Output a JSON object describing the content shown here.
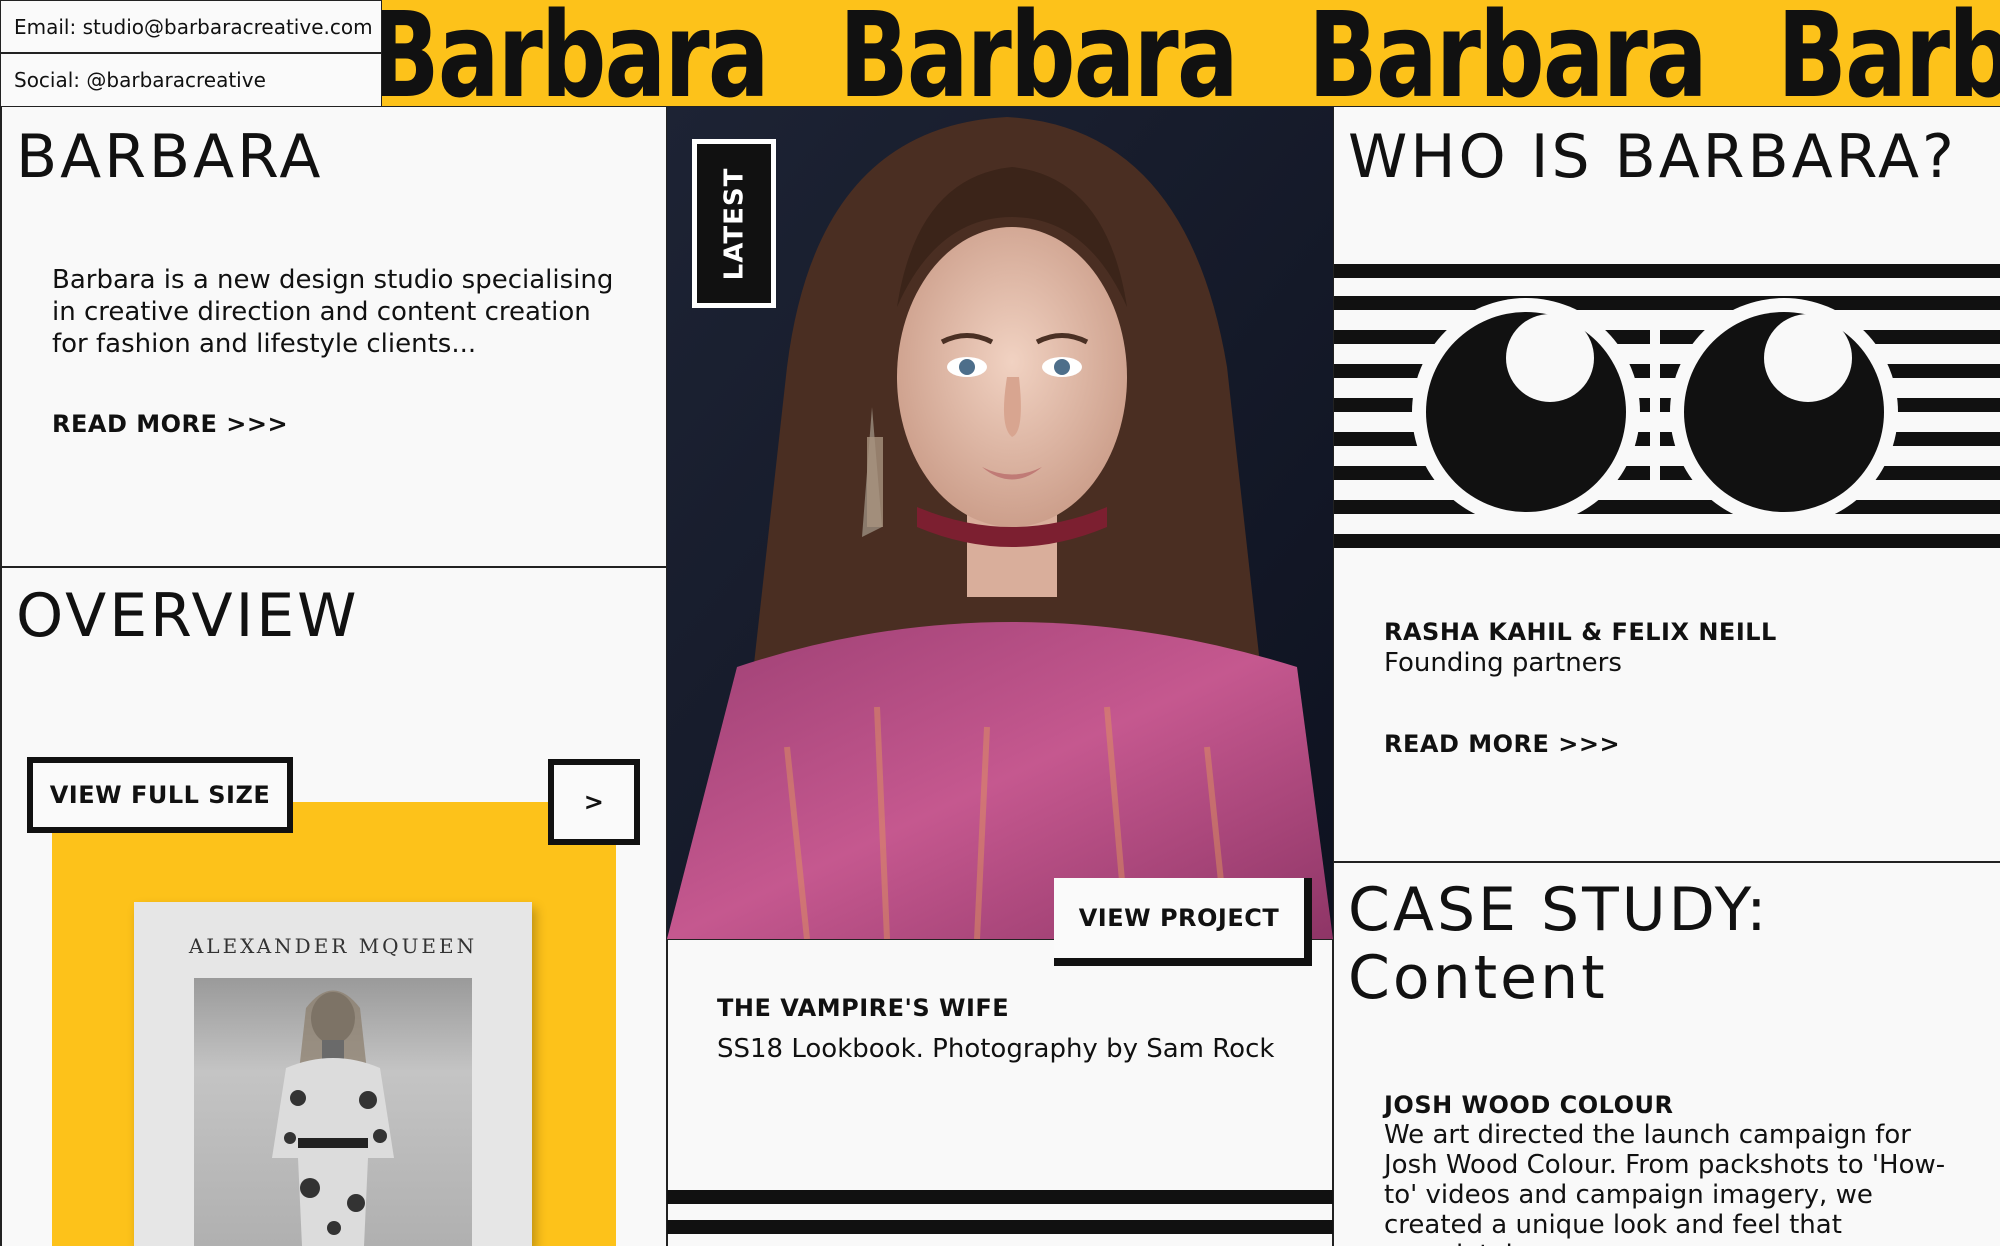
{
  "header": {
    "email": "Email: studio@barbaracreative.com",
    "social": "Social: @barbaracreative",
    "marquee_word": "Barbara"
  },
  "intro": {
    "title": "BARBARA",
    "text": "Barbara is a new design studio specialising in creative direction and content creation for fashion and lifestyle clients...",
    "read_more": "READ MORE >>>"
  },
  "overview": {
    "title": "OVERVIEW",
    "view_full_size": "VIEW FULL SIZE",
    "next": ">",
    "book_title": "ALEXANDER MQUEEN"
  },
  "latest": {
    "tag": "LATEST",
    "view_project": "VIEW PROJECT",
    "project_title": "THE VAMPIRE'S WIFE",
    "project_subtitle": "SS18 Lookbook. Photography by Sam Rock"
  },
  "who": {
    "title": "WHO IS BARBARA?",
    "partners": "RASHA KAHIL & FELIX NEILL",
    "role": "Founding partners",
    "read_more": "READ MORE >>>"
  },
  "case_study": {
    "title_line1": "CASE STUDY:",
    "title_line2": "Content",
    "client": "JOSH WOOD COLOUR",
    "text": "We art directed the launch campaign for Josh Wood Colour. From packshots to 'How-to' videos and campaign imagery, we created a unique look and feel that completely"
  },
  "colors": {
    "accent_yellow": "#fdc21a",
    "ink": "#111111",
    "paper": "#f9f9f9"
  }
}
